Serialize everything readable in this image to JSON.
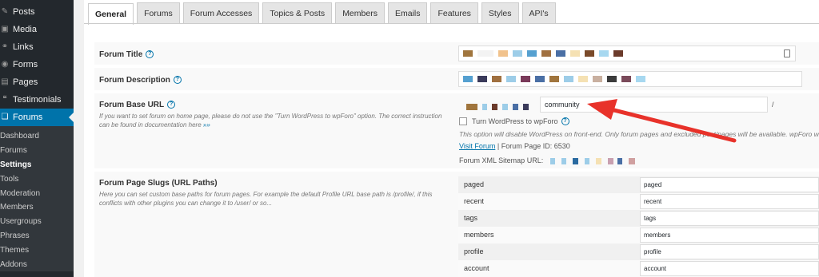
{
  "sidebar": {
    "items": [
      {
        "label": "Posts",
        "icon": "pin-icon"
      },
      {
        "label": "Media",
        "icon": "media-icon"
      },
      {
        "label": "Links",
        "icon": "link-icon"
      },
      {
        "label": "Forms",
        "icon": "forms-icon"
      },
      {
        "label": "Pages",
        "icon": "pages-icon"
      },
      {
        "label": "Testimonials",
        "icon": "testimonials-icon"
      },
      {
        "label": "Forums",
        "icon": "forums-icon"
      }
    ],
    "submenu": [
      "Dashboard",
      "Forums",
      "Settings",
      "Tools",
      "Moderation",
      "Members",
      "Usergroups",
      "Phrases",
      "Themes",
      "Addons"
    ],
    "current_submenu": "Settings"
  },
  "tabs": [
    "General",
    "Forums",
    "Forum Accesses",
    "Topics & Posts",
    "Members",
    "Emails",
    "Features",
    "Styles",
    "API's"
  ],
  "active_tab": "General",
  "fields": {
    "forum_title": {
      "label": "Forum Title"
    },
    "forum_description": {
      "label": "Forum Description"
    },
    "forum_base_url": {
      "label": "Forum Base URL",
      "description": "If you want to set forum on home page, please do not use the \"Turn WordPress to wpForo\" option. The correct instruction can be found in documentation here",
      "description_link": "»»",
      "value": "community",
      "suffix": "/",
      "checkbox_label": "Turn WordPress to wpForo",
      "checkbox_note": "This option will disable WordPress on front-end. Only forum pages and excluded post/pages will be available. wpForo will look",
      "visit_link": "Visit Forum",
      "page_id": "| Forum Page ID: 6530",
      "sitemap_label": "Forum XML Sitemap URL:"
    },
    "page_slugs": {
      "label": "Forum Page Slugs (URL Paths)",
      "description": "Here you can set custom base paths for forum pages. For example the default Profile URL base path is /profile/, if this conflicts with other plugins you can change it to /user/ or so...",
      "rows": [
        {
          "key": "paged",
          "value": "paged"
        },
        {
          "key": "recent",
          "value": "recent"
        },
        {
          "key": "tags",
          "value": "tags"
        },
        {
          "key": "members",
          "value": "members"
        },
        {
          "key": "profile",
          "value": "profile"
        },
        {
          "key": "account",
          "value": "account"
        }
      ]
    }
  },
  "colors": {
    "sidebar_bg": "#23282d",
    "active": "#0073aa",
    "arrow": "#e8322a"
  }
}
